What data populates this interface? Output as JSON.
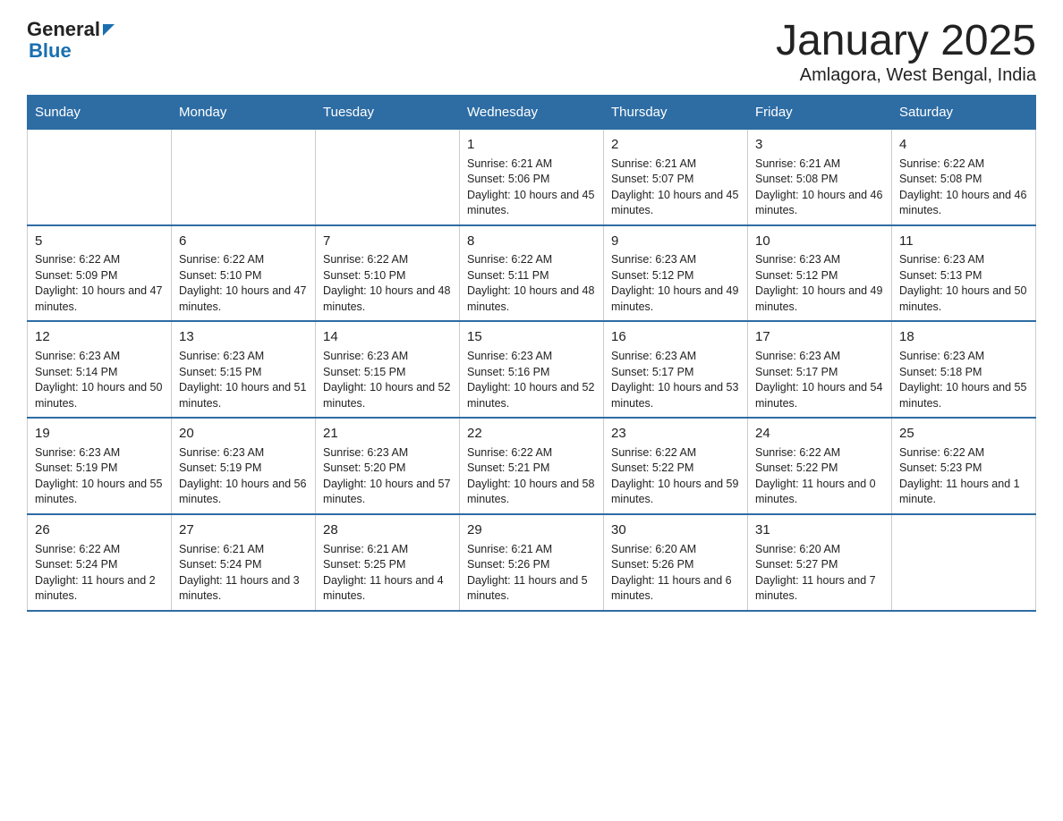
{
  "header": {
    "logo": {
      "general": "General",
      "arrow": "▶",
      "blue": "Blue"
    },
    "title": "January 2025",
    "subtitle": "Amlagora, West Bengal, India"
  },
  "days": [
    "Sunday",
    "Monday",
    "Tuesday",
    "Wednesday",
    "Thursday",
    "Friday",
    "Saturday"
  ],
  "weeks": [
    [
      {
        "num": "",
        "info": ""
      },
      {
        "num": "",
        "info": ""
      },
      {
        "num": "",
        "info": ""
      },
      {
        "num": "1",
        "info": "Sunrise: 6:21 AM\nSunset: 5:06 PM\nDaylight: 10 hours and 45 minutes."
      },
      {
        "num": "2",
        "info": "Sunrise: 6:21 AM\nSunset: 5:07 PM\nDaylight: 10 hours and 45 minutes."
      },
      {
        "num": "3",
        "info": "Sunrise: 6:21 AM\nSunset: 5:08 PM\nDaylight: 10 hours and 46 minutes."
      },
      {
        "num": "4",
        "info": "Sunrise: 6:22 AM\nSunset: 5:08 PM\nDaylight: 10 hours and 46 minutes."
      }
    ],
    [
      {
        "num": "5",
        "info": "Sunrise: 6:22 AM\nSunset: 5:09 PM\nDaylight: 10 hours and 47 minutes."
      },
      {
        "num": "6",
        "info": "Sunrise: 6:22 AM\nSunset: 5:10 PM\nDaylight: 10 hours and 47 minutes."
      },
      {
        "num": "7",
        "info": "Sunrise: 6:22 AM\nSunset: 5:10 PM\nDaylight: 10 hours and 48 minutes."
      },
      {
        "num": "8",
        "info": "Sunrise: 6:22 AM\nSunset: 5:11 PM\nDaylight: 10 hours and 48 minutes."
      },
      {
        "num": "9",
        "info": "Sunrise: 6:23 AM\nSunset: 5:12 PM\nDaylight: 10 hours and 49 minutes."
      },
      {
        "num": "10",
        "info": "Sunrise: 6:23 AM\nSunset: 5:12 PM\nDaylight: 10 hours and 49 minutes."
      },
      {
        "num": "11",
        "info": "Sunrise: 6:23 AM\nSunset: 5:13 PM\nDaylight: 10 hours and 50 minutes."
      }
    ],
    [
      {
        "num": "12",
        "info": "Sunrise: 6:23 AM\nSunset: 5:14 PM\nDaylight: 10 hours and 50 minutes."
      },
      {
        "num": "13",
        "info": "Sunrise: 6:23 AM\nSunset: 5:15 PM\nDaylight: 10 hours and 51 minutes."
      },
      {
        "num": "14",
        "info": "Sunrise: 6:23 AM\nSunset: 5:15 PM\nDaylight: 10 hours and 52 minutes."
      },
      {
        "num": "15",
        "info": "Sunrise: 6:23 AM\nSunset: 5:16 PM\nDaylight: 10 hours and 52 minutes."
      },
      {
        "num": "16",
        "info": "Sunrise: 6:23 AM\nSunset: 5:17 PM\nDaylight: 10 hours and 53 minutes."
      },
      {
        "num": "17",
        "info": "Sunrise: 6:23 AM\nSunset: 5:17 PM\nDaylight: 10 hours and 54 minutes."
      },
      {
        "num": "18",
        "info": "Sunrise: 6:23 AM\nSunset: 5:18 PM\nDaylight: 10 hours and 55 minutes."
      }
    ],
    [
      {
        "num": "19",
        "info": "Sunrise: 6:23 AM\nSunset: 5:19 PM\nDaylight: 10 hours and 55 minutes."
      },
      {
        "num": "20",
        "info": "Sunrise: 6:23 AM\nSunset: 5:19 PM\nDaylight: 10 hours and 56 minutes."
      },
      {
        "num": "21",
        "info": "Sunrise: 6:23 AM\nSunset: 5:20 PM\nDaylight: 10 hours and 57 minutes."
      },
      {
        "num": "22",
        "info": "Sunrise: 6:22 AM\nSunset: 5:21 PM\nDaylight: 10 hours and 58 minutes."
      },
      {
        "num": "23",
        "info": "Sunrise: 6:22 AM\nSunset: 5:22 PM\nDaylight: 10 hours and 59 minutes."
      },
      {
        "num": "24",
        "info": "Sunrise: 6:22 AM\nSunset: 5:22 PM\nDaylight: 11 hours and 0 minutes."
      },
      {
        "num": "25",
        "info": "Sunrise: 6:22 AM\nSunset: 5:23 PM\nDaylight: 11 hours and 1 minute."
      }
    ],
    [
      {
        "num": "26",
        "info": "Sunrise: 6:22 AM\nSunset: 5:24 PM\nDaylight: 11 hours and 2 minutes."
      },
      {
        "num": "27",
        "info": "Sunrise: 6:21 AM\nSunset: 5:24 PM\nDaylight: 11 hours and 3 minutes."
      },
      {
        "num": "28",
        "info": "Sunrise: 6:21 AM\nSunset: 5:25 PM\nDaylight: 11 hours and 4 minutes."
      },
      {
        "num": "29",
        "info": "Sunrise: 6:21 AM\nSunset: 5:26 PM\nDaylight: 11 hours and 5 minutes."
      },
      {
        "num": "30",
        "info": "Sunrise: 6:20 AM\nSunset: 5:26 PM\nDaylight: 11 hours and 6 minutes."
      },
      {
        "num": "31",
        "info": "Sunrise: 6:20 AM\nSunset: 5:27 PM\nDaylight: 11 hours and 7 minutes."
      },
      {
        "num": "",
        "info": ""
      }
    ]
  ]
}
